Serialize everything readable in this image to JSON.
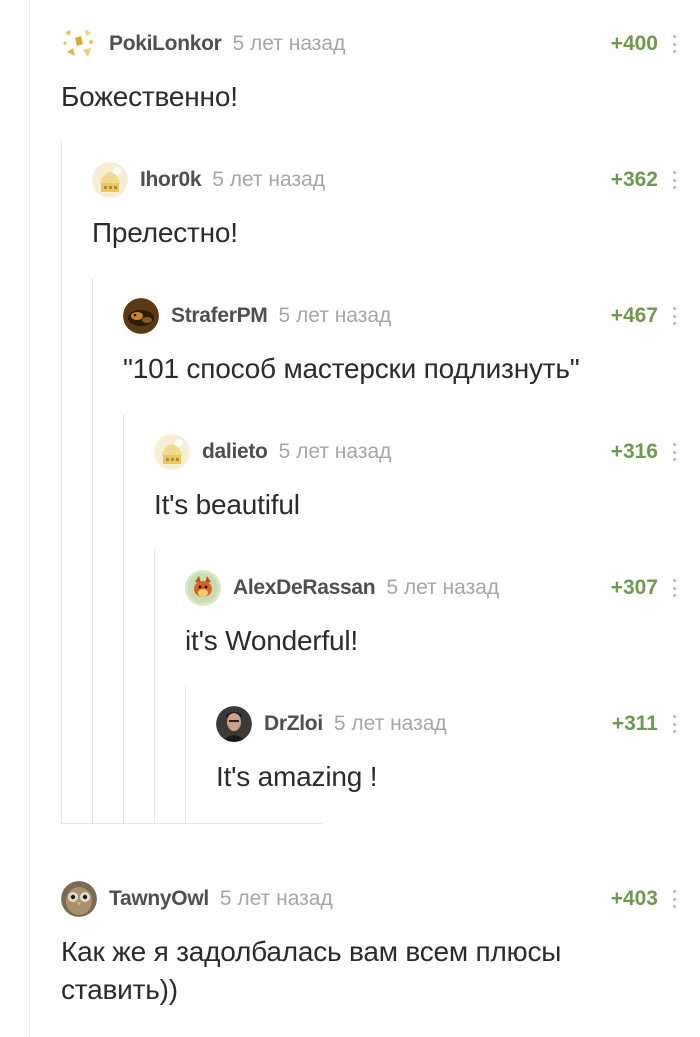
{
  "comments": [
    {
      "user": "PokiLonkor",
      "time": "5 лет назад",
      "rating": "+400",
      "text": "Божественно!"
    },
    {
      "user": "Ihor0k",
      "time": "5 лет назад",
      "rating": "+362",
      "text": "Прелестно!"
    },
    {
      "user": "StraferPM",
      "time": "5 лет назад",
      "rating": "+467",
      "text": "\"101 способ мастерски подлизнуть\""
    },
    {
      "user": "dalieto",
      "time": "5 лет назад",
      "rating": "+316",
      "text": "It's beautiful"
    },
    {
      "user": "AlexDeRassan",
      "time": "5 лет назад",
      "rating": "+307",
      "text": "it's Wonderful!"
    },
    {
      "user": "DrZloi",
      "time": "5 лет назад",
      "rating": "+311",
      "text": "It's amazing !"
    },
    {
      "user": "TawnyOwl",
      "time": "5 лет назад",
      "rating": "+403",
      "text": "Как же я задолбалась вам всем плюсы ставить))"
    }
  ],
  "avatars": [
    "sparkle-avatar",
    "default-avatar",
    "bird-avatar",
    "default-avatar",
    "fox-avatar",
    "photo-avatar",
    "owl-avatar"
  ],
  "colors": {
    "rating": "#6d9a4c",
    "username": "#4f4f4f",
    "time": "#a6a6a6",
    "text": "#2b2b2b"
  }
}
